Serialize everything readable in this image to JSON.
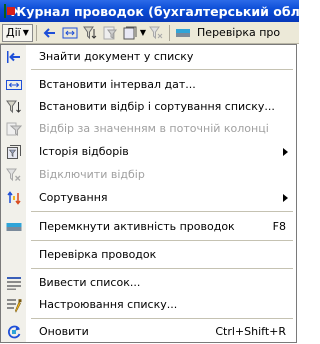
{
  "window": {
    "title": "Журнал проводок (бухгалтерський облік)"
  },
  "toolbar": {
    "actions_label": "Дії",
    "check_label": "Перевірка про"
  },
  "menu": {
    "items": [
      {
        "label": "Знайти документ у списку",
        "shortcut": "",
        "submenu": false,
        "enabled": true,
        "icon": "find-document-icon"
      },
      {
        "label": "Встановити інтервал дат...",
        "shortcut": "",
        "submenu": false,
        "enabled": true,
        "icon": "date-interval-icon"
      },
      {
        "label": "Встановити відбір і сортування списку...",
        "shortcut": "",
        "submenu": false,
        "enabled": true,
        "icon": "filter-sort-icon"
      },
      {
        "label": "Відбір за значенням в поточній колонці",
        "shortcut": "",
        "submenu": false,
        "enabled": false,
        "icon": "filter-by-value-icon"
      },
      {
        "label": "Історія відборів",
        "shortcut": "",
        "submenu": true,
        "enabled": true,
        "icon": "filter-history-icon"
      },
      {
        "label": "Відключити відбір",
        "shortcut": "",
        "submenu": false,
        "enabled": false,
        "icon": "disable-filter-icon"
      },
      {
        "label": "Сортування",
        "shortcut": "",
        "submenu": true,
        "enabled": true,
        "icon": "sort-icon"
      },
      {
        "label": "Перемкнути активність проводок",
        "shortcut": "F8",
        "submenu": false,
        "enabled": true,
        "icon": "toggle-activity-icon"
      },
      {
        "label": "Перевірка проводок",
        "shortcut": "",
        "submenu": false,
        "enabled": true,
        "icon": ""
      },
      {
        "label": "Вивести список...",
        "shortcut": "",
        "submenu": false,
        "enabled": true,
        "icon": "output-list-icon"
      },
      {
        "label": "Настроювання списку...",
        "shortcut": "",
        "submenu": false,
        "enabled": true,
        "icon": "list-settings-icon"
      },
      {
        "label": "Оновити",
        "shortcut": "Ctrl+Shift+R",
        "submenu": false,
        "enabled": true,
        "icon": "refresh-icon"
      }
    ]
  },
  "colors": {
    "title_bar": "#0a4cd6",
    "menu_gutter": "#f1f0ea",
    "disabled_text": "#a0a0a0",
    "toolbar_bg": "#ece9d8"
  }
}
